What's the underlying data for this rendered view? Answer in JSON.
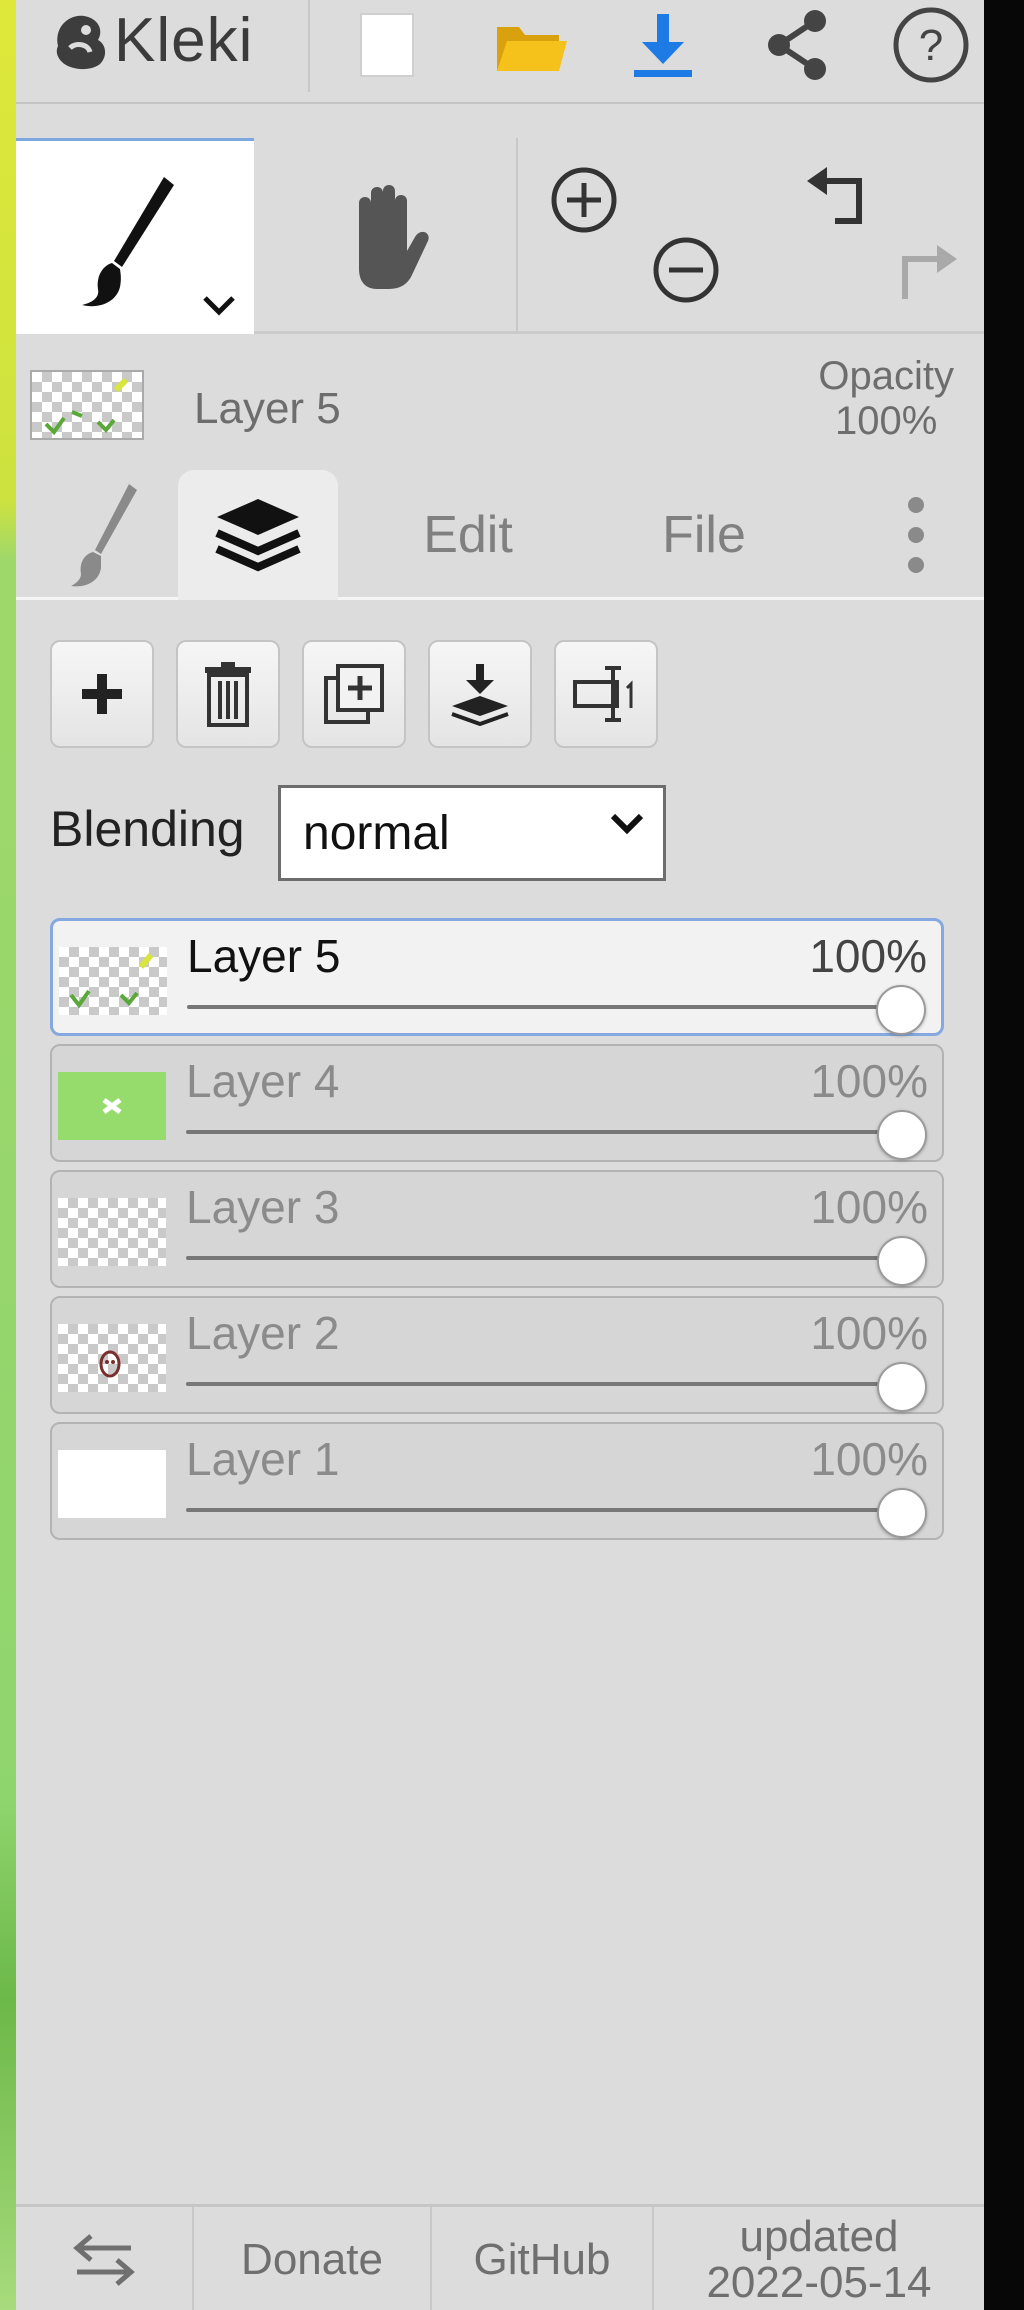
{
  "app": {
    "name": "Kleki"
  },
  "top_toolbar": {
    "buttons": [
      {
        "name": "new-image",
        "icon": "blank-page-icon"
      },
      {
        "name": "open-file",
        "icon": "folder-icon",
        "color": "#f4c21b"
      },
      {
        "name": "save",
        "icon": "download-icon",
        "color": "#1e7be6"
      },
      {
        "name": "share",
        "icon": "share-icon"
      },
      {
        "name": "help",
        "icon": "help-circle-icon",
        "label": "?"
      }
    ]
  },
  "tools": {
    "brush": {
      "icon": "brush-icon",
      "active": true
    },
    "hand": {
      "icon": "hand-icon"
    },
    "zoom_in": {
      "icon": "zoom-in-icon"
    },
    "zoom_out": {
      "icon": "zoom-out-icon"
    },
    "undo": {
      "icon": "undo-icon"
    },
    "redo": {
      "icon": "redo-icon"
    }
  },
  "current_layer": {
    "name": "Layer 5",
    "opacity_label": "Opacity",
    "opacity_value": "100%"
  },
  "tabs": [
    {
      "id": "brush",
      "icon": "brush-icon"
    },
    {
      "id": "layers",
      "icon": "layers-icon",
      "active": true
    },
    {
      "id": "edit",
      "label": "Edit"
    },
    {
      "id": "file",
      "label": "File"
    },
    {
      "id": "more",
      "icon": "more-vertical-icon"
    }
  ],
  "layer_actions": [
    {
      "name": "add-layer",
      "icon": "plus-icon"
    },
    {
      "name": "delete-layer",
      "icon": "trash-icon"
    },
    {
      "name": "duplicate-layer",
      "icon": "duplicate-icon"
    },
    {
      "name": "merge-down",
      "icon": "merge-down-icon"
    },
    {
      "name": "rename-layer",
      "icon": "rename-icon"
    }
  ],
  "blending": {
    "label": "Blending",
    "value": "normal"
  },
  "layers": [
    {
      "name": "Layer 5",
      "opacity": "100%",
      "opacity_fraction": 1.0,
      "selected": true
    },
    {
      "name": "Layer 4",
      "opacity": "100%",
      "opacity_fraction": 1.0,
      "selected": false
    },
    {
      "name": "Layer 3",
      "opacity": "100%",
      "opacity_fraction": 1.0,
      "selected": false
    },
    {
      "name": "Layer 2",
      "opacity": "100%",
      "opacity_fraction": 1.0,
      "selected": false
    },
    {
      "name": "Layer 1",
      "opacity": "100%",
      "opacity_fraction": 1.0,
      "selected": false
    }
  ],
  "bottom_bar": {
    "swap_icon": "swap-arrows-icon",
    "donate": "Donate",
    "github": "GitHub",
    "updated_label": "updated",
    "updated_date": "2022-05-14"
  },
  "colors": {
    "panel_bg": "#dcdcdc",
    "accent_blue": "#7da7df",
    "folder_yellow": "#f4c21b",
    "download_blue": "#1e7be6",
    "layer4_green": "#96dc6c"
  }
}
